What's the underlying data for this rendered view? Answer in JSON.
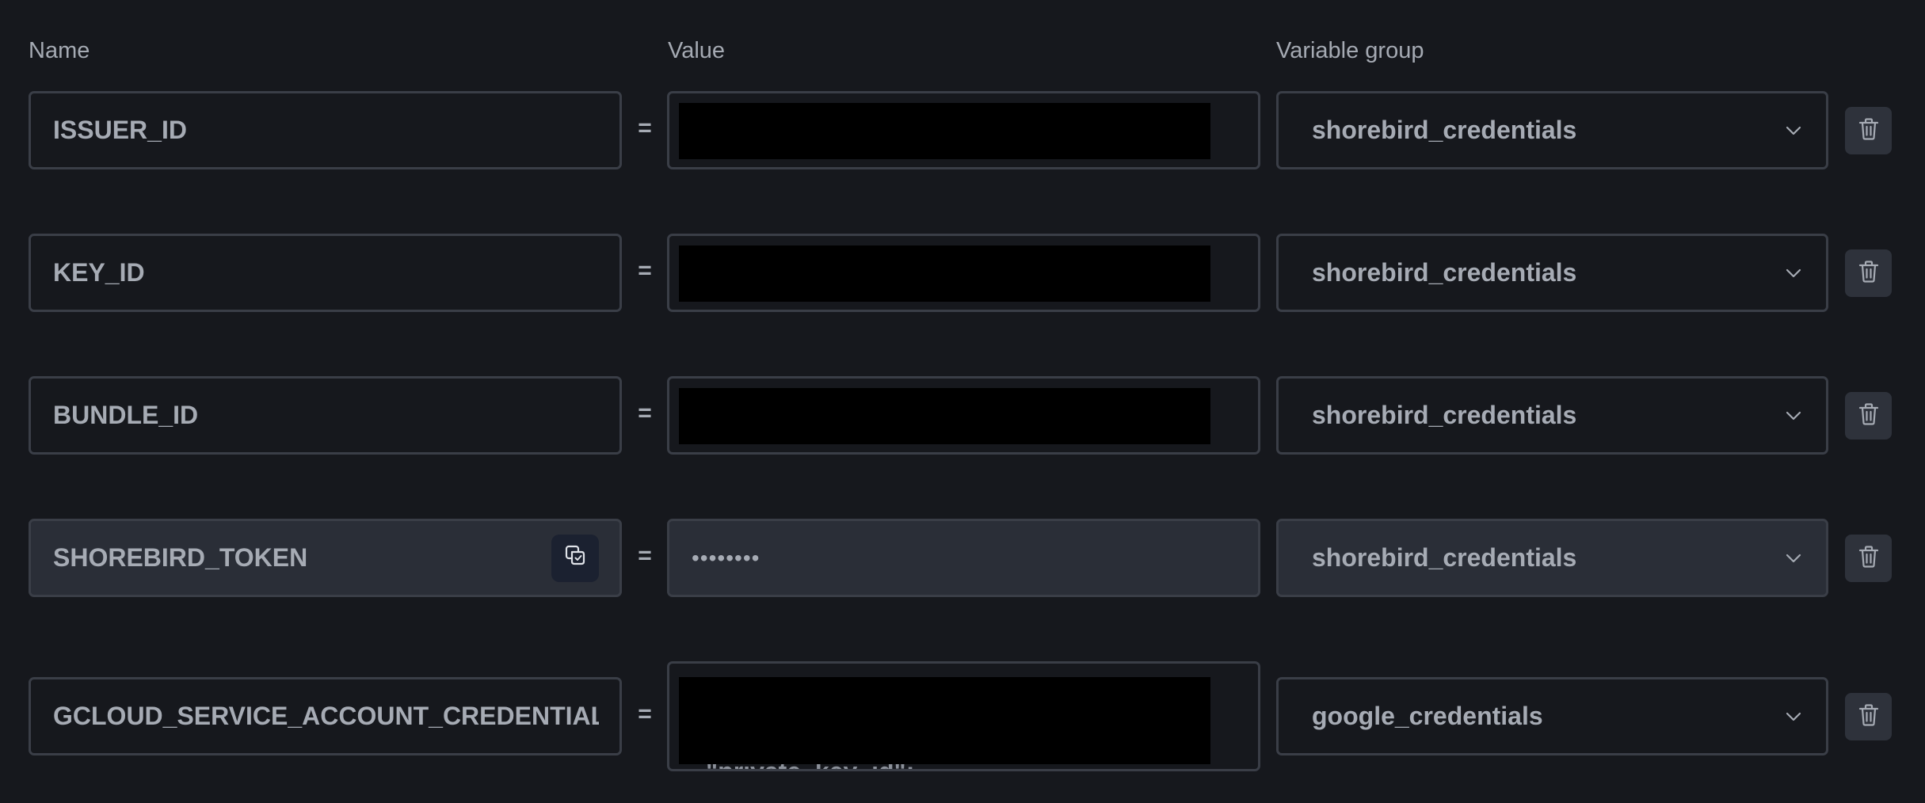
{
  "headers": {
    "name": "Name",
    "value": "Value",
    "group": "Variable group"
  },
  "separator": "=",
  "variables": [
    {
      "name": "ISSUER_ID",
      "value": "",
      "value_redacted": true,
      "group": "shorebird_credentials"
    },
    {
      "name": "KEY_ID",
      "value": "",
      "value_redacted": true,
      "group": "shorebird_credentials"
    },
    {
      "name": "BUNDLE_ID",
      "value": "",
      "value_redacted": true,
      "group": "shorebird_credentials"
    },
    {
      "name": "SHOREBIRD_TOKEN",
      "value": "••••••••",
      "value_redacted": false,
      "group": "shorebird_credentials",
      "hovered": true
    },
    {
      "name": "GCLOUD_SERVICE_ACCOUNT_CREDENTIALS",
      "value": "\"private_key_id\":",
      "value_redacted": true,
      "group": "google_credentials"
    }
  ],
  "icons": {
    "copy": "copy-icon",
    "chevron": "chevron-down-icon",
    "delete": "trash-icon"
  },
  "colors": {
    "background": "#16181d",
    "border": "#3a3e47",
    "text": "#a6abb4",
    "active_field": "#2a2e37",
    "copy_button": "#1b2130",
    "delete_button": "#2e323b"
  }
}
